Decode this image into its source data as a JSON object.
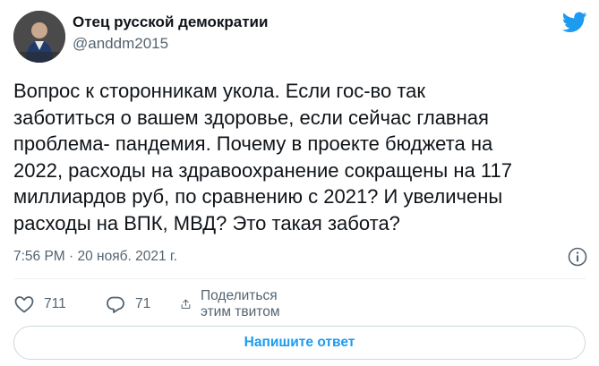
{
  "author": {
    "name": "Отец русской демократии",
    "handle": "@anddm2015"
  },
  "tweet": {
    "lines": [
      "Вопрос к сторонникам укола. Если гос-во так",
      "заботиться о вашем здоровье, если сейчас главная",
      "проблема- пандемия. Почему в проекте бюджета на",
      "2022, расходы на здравоохранение сокращены на 117",
      "миллиардов руб, по сравнению с 2021? И увеличены",
      "расходы на ВПК, МВД? Это такая забота?"
    ],
    "timestamp": "7:56 PM · 20 нояб. 2021 г."
  },
  "actions": {
    "likes": "711",
    "replies": "71",
    "share_label": "Поделиться этим твитом"
  },
  "reply_button_label": "Напишите ответ",
  "colors": {
    "brand": "#1d9bf0",
    "text": "#0f1419",
    "muted": "#536471",
    "border": "#cfd9de"
  },
  "icons": [
    "twitter-bird-icon",
    "info-icon",
    "heart-icon",
    "reply-bubble-icon",
    "share-icon"
  ]
}
